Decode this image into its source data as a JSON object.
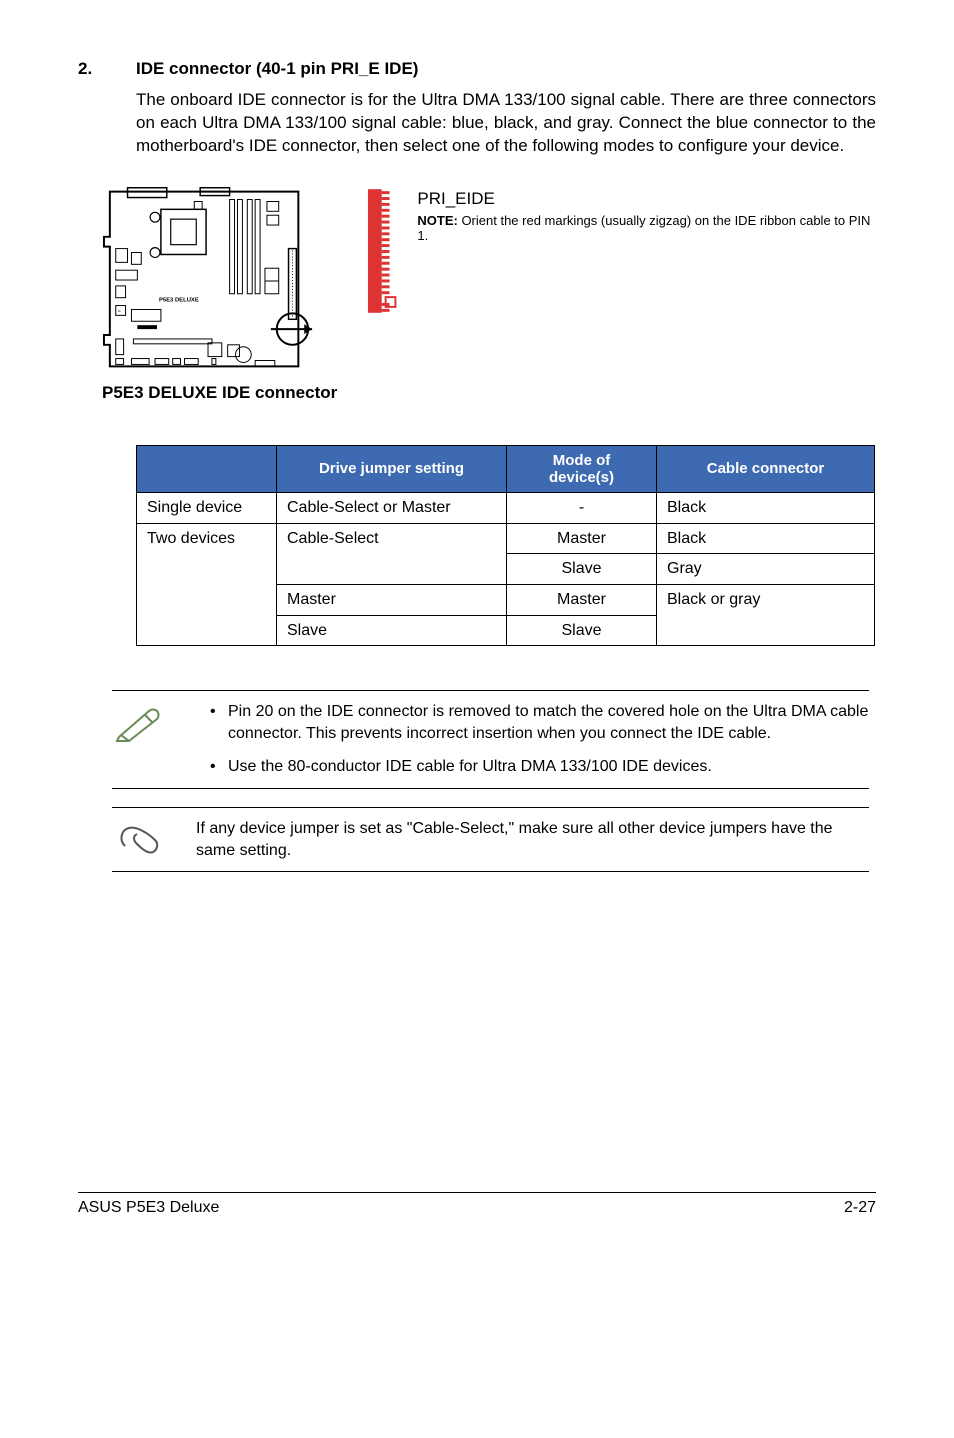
{
  "section": {
    "number": "2.",
    "title": "IDE connector (40-1 pin PRI_E IDE)",
    "body": "The onboard IDE connector is for the Ultra DMA 133/100 signal cable. There are three connectors on each Ultra DMA 133/100 signal cable: blue, black, and gray. Connect the blue connector to the motherboard's IDE connector, then select one of the following modes to configure your device."
  },
  "diagram": {
    "board_label": "P5E3 DELUXE",
    "connector_name": "PRI_EIDE",
    "note_label": "NOTE:",
    "note_text": " Orient the red markings (usually zigzag) on the IDE ribbon cable to PIN 1.",
    "caption": "P5E3 DELUXE IDE connector"
  },
  "table": {
    "headers": {
      "col1": "",
      "col2": "Drive jumper setting",
      "col3_line1": "Mode of",
      "col3_line2": "device(s)",
      "col4": "Cable connector"
    },
    "rows": {
      "r1c1": "Single device",
      "r1c2": "Cable-Select or Master",
      "r1c3": "-",
      "r1c4": "Black",
      "r2c1": "Two devices",
      "r2c2": "Cable-Select",
      "r2c3": "Master",
      "r2c4": "Black",
      "r3c3": "Slave",
      "r3c4": "Gray",
      "r4c2": "Master",
      "r4c3": "Master",
      "r4c4": "Black or gray",
      "r5c2": "Slave",
      "r5c3": "Slave"
    }
  },
  "notes": {
    "bullet1": "Pin 20 on the IDE connector is removed to match the covered hole on the Ultra DMA cable connector. This prevents incorrect insertion when you connect the IDE cable.",
    "bullet2": "Use the 80-conductor IDE cable for Ultra DMA 133/100 IDE devices.",
    "tip": "If any device jumper is set as \"Cable-Select,\" make sure all other device jumpers have the same setting."
  },
  "footer": {
    "left": "ASUS P5E3 Deluxe",
    "right": "2-27"
  }
}
